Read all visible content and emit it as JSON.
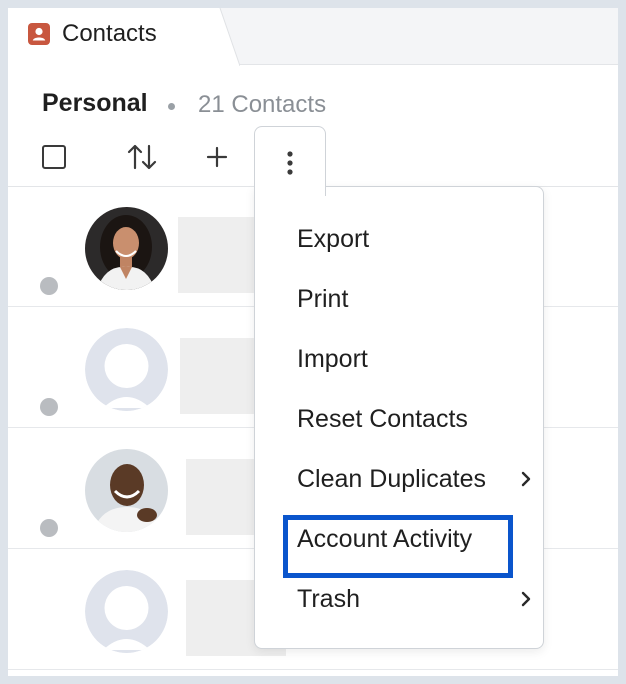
{
  "tab": {
    "label": "Contacts",
    "icon": "contact-card-icon",
    "icon_color": "#c8573f"
  },
  "header": {
    "title": "Personal",
    "separator": "•",
    "count": "21 Contacts"
  },
  "toolbar": {
    "select_all": "checkbox-icon",
    "sort": "sort-icon",
    "add": "plus-icon",
    "more": "more-vertical-icon"
  },
  "contacts": [
    {
      "avatar": "photo-woman",
      "status": "offline"
    },
    {
      "avatar": "placeholder",
      "status": "offline"
    },
    {
      "avatar": "photo-man",
      "status": "offline"
    },
    {
      "avatar": "placeholder",
      "status": "none"
    }
  ],
  "menu": {
    "items": [
      {
        "label": "Export",
        "submenu": false
      },
      {
        "label": "Print",
        "submenu": false
      },
      {
        "label": "Import",
        "submenu": false
      },
      {
        "label": "Reset Contacts",
        "submenu": false
      },
      {
        "label": "Clean Duplicates",
        "submenu": true
      },
      {
        "label": "Account Activity",
        "submenu": false,
        "highlighted": true
      },
      {
        "label": "Trash",
        "submenu": true
      }
    ],
    "highlight_color": "#0a55cc"
  }
}
